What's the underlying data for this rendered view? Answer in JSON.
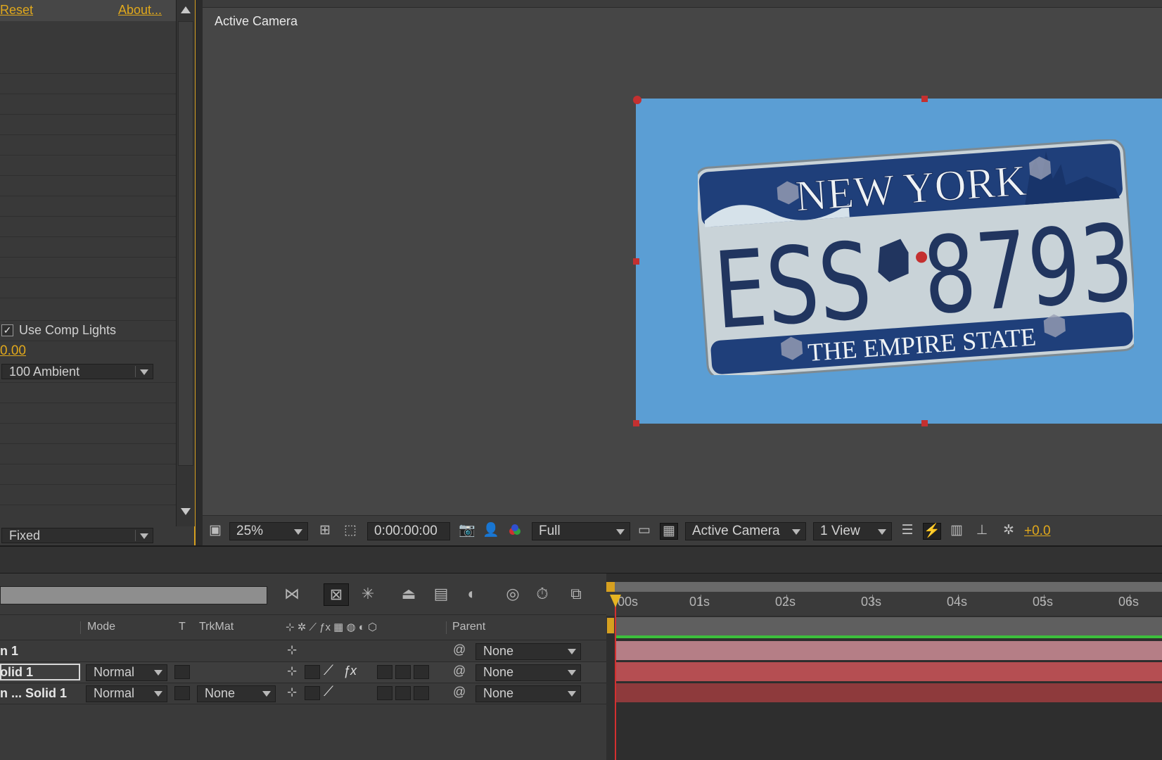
{
  "effects_panel": {
    "reset_label": "Reset",
    "about_label": "About...",
    "use_comp_lights_label": "Use Comp Lights",
    "use_comp_lights_checked": true,
    "value": "0.00",
    "ambient_select": "100 Ambient",
    "fixed_select": "Fixed"
  },
  "viewer": {
    "camera_label": "Active Camera",
    "zoom": "25%",
    "timecode": "0:00:00:00",
    "resolution": "Full",
    "camera_select": "Active Camera",
    "view_select": "1 View",
    "exposure": "+0.0"
  },
  "plate": {
    "state": "NEW YORK",
    "number_left": "ESS",
    "number_right": "8793",
    "slogan": "THE EMPIRE STATE"
  },
  "timeline": {
    "columns": {
      "mode": "Mode",
      "t": "T",
      "trkmat": "TrkMat",
      "parent": "Parent"
    },
    "ruler": [
      "00s",
      "01s",
      "02s",
      "03s",
      "04s",
      "05s",
      "06s"
    ],
    "layers": [
      {
        "name": "n 1",
        "mode": "",
        "trkmat": "",
        "parent": "None"
      },
      {
        "name": "olid 1",
        "mode": "Normal",
        "trkmat": "",
        "parent": "None"
      },
      {
        "name": "n ... Solid 1",
        "mode": "Normal",
        "trkmat": "None",
        "parent": "None"
      }
    ]
  },
  "colors": {
    "accent": "#e0a81c",
    "comp_bg": "#5b9ed4",
    "handle": "#c43030",
    "layer_bar_1": "#b57e86",
    "layer_bar_2": "#b54e52",
    "layer_bar_3": "#8e3a3c",
    "work_area": "#3cbf3c"
  }
}
